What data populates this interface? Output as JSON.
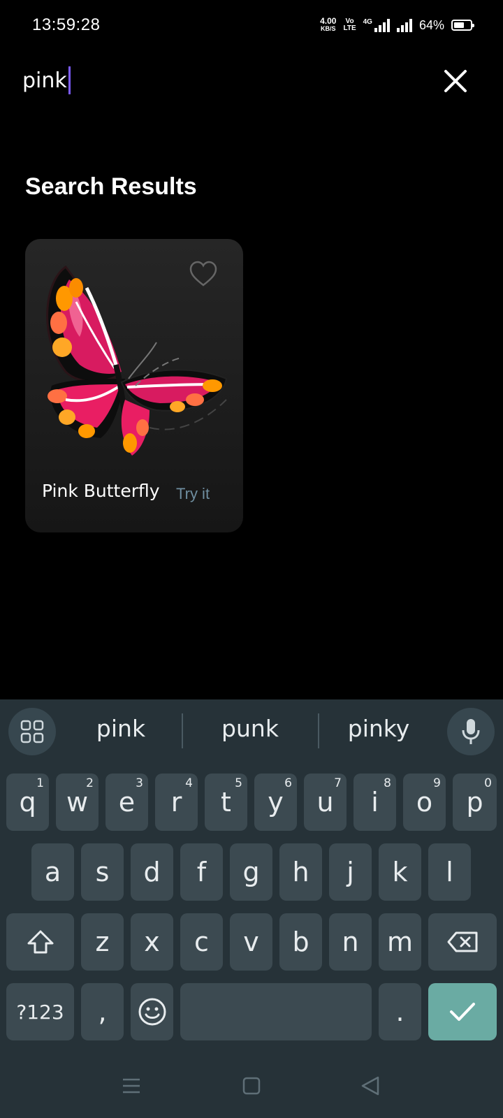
{
  "status_bar": {
    "time": "13:59:28",
    "net_speed_value": "4.00",
    "net_speed_unit": "KB/S",
    "volte_top": "Vo",
    "volte_bottom": "LTE",
    "network_type": "4G",
    "battery_percent": "64%",
    "battery_level": 0.64
  },
  "search": {
    "query": "pink",
    "close_icon": "close-icon"
  },
  "results": {
    "title": "Search Results",
    "items": [
      {
        "name": "Pink Butterfly",
        "action": "Try it",
        "favorite_icon": "heart-outline-icon"
      }
    ]
  },
  "keyboard": {
    "suggestions": [
      "pink",
      "punk",
      "pinky"
    ],
    "row1": [
      {
        "key": "q",
        "hint": "1"
      },
      {
        "key": "w",
        "hint": "2"
      },
      {
        "key": "e",
        "hint": "3"
      },
      {
        "key": "r",
        "hint": "4"
      },
      {
        "key": "t",
        "hint": "5"
      },
      {
        "key": "y",
        "hint": "6"
      },
      {
        "key": "u",
        "hint": "7"
      },
      {
        "key": "i",
        "hint": "8"
      },
      {
        "key": "o",
        "hint": "9"
      },
      {
        "key": "p",
        "hint": "0"
      }
    ],
    "row2": [
      "a",
      "s",
      "d",
      "f",
      "g",
      "h",
      "j",
      "k",
      "l"
    ],
    "row3": [
      "z",
      "x",
      "c",
      "v",
      "b",
      "n",
      "m"
    ],
    "symbols_label": "?123",
    "comma_label": ",",
    "period_label": ".",
    "accent_color": "#6aaba3"
  }
}
